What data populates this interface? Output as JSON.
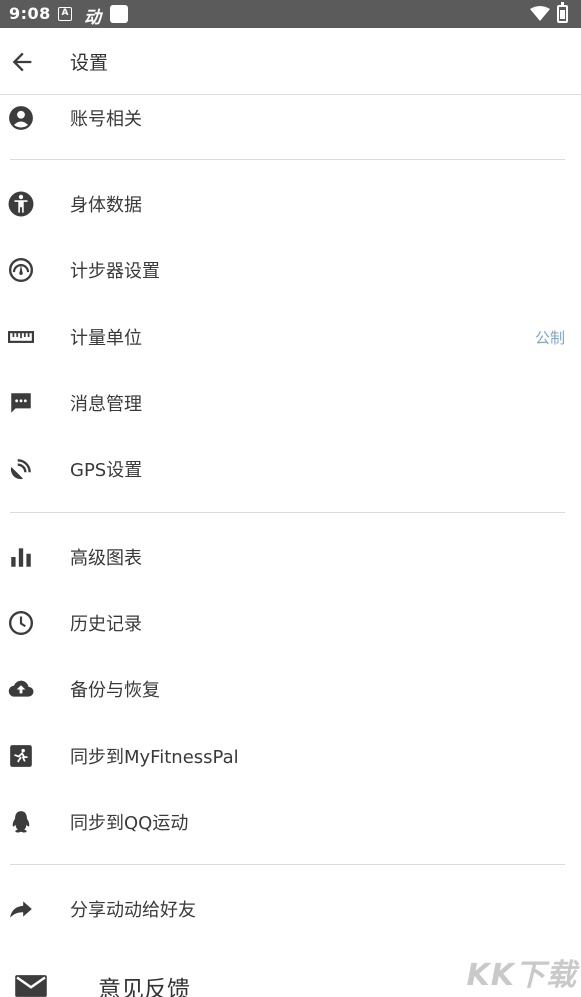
{
  "status_bar": {
    "time": "9:08",
    "app_icon_letter": "A",
    "app_glyph": "动"
  },
  "app_bar": {
    "title": "设置"
  },
  "menu": {
    "account": {
      "label": "账号相关",
      "icon": "account-circle-icon"
    },
    "body_data": {
      "label": "身体数据",
      "icon": "person-icon"
    },
    "pedometer": {
      "label": "计步器设置",
      "icon": "pedometer-gauge-icon"
    },
    "units": {
      "label": "计量单位",
      "value": "公制",
      "icon": "ruler-icon"
    },
    "messages": {
      "label": "消息管理",
      "icon": "message-icon"
    },
    "gps": {
      "label": "GPS设置",
      "icon": "satellite-icon"
    },
    "charts": {
      "label": "高级图表",
      "icon": "bar-chart-icon"
    },
    "history": {
      "label": "历史记录",
      "icon": "clock-icon"
    },
    "backup": {
      "label": "备份与恢复",
      "icon": "cloud-upload-icon"
    },
    "myfitnesspal": {
      "label": "同步到MyFitnessPal",
      "icon": "myfitnesspal-icon"
    },
    "qq": {
      "label": "同步到QQ运动",
      "icon": "qq-penguin-icon"
    },
    "share": {
      "label": "分享动动给好友",
      "icon": "share-arrow-icon"
    },
    "feedback": {
      "label": "意见反馈",
      "icon": "mail-icon"
    }
  },
  "watermark": {
    "text": "KK下载"
  },
  "colors": {
    "status_bar_bg": "#5b5b5b",
    "icon": "#3c3c3c",
    "value_accent": "#7da6c4",
    "divider": "#dcdcdc"
  }
}
